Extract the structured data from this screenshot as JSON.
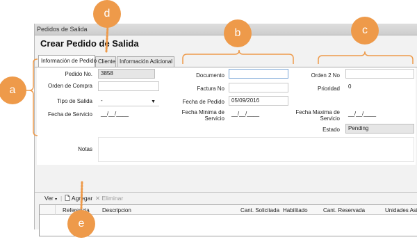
{
  "window": {
    "title": "Pedidos de Salida"
  },
  "header": {
    "title": "Crear Pedido de Salida"
  },
  "tabs": [
    "Información de Pedido",
    "Cliente",
    "Información Adicional"
  ],
  "form": {
    "pedido_no_label": "Pedido No.",
    "pedido_no_value": "3858",
    "orden_compra_label": "Orden de Compra",
    "tipo_salida_label": "Tipo de Salida",
    "tipo_salida_value": "-",
    "fecha_servicio_label": "Fecha de Servicio",
    "fecha_servicio_value": "__/__/____",
    "documento_label": "Documento",
    "factura_no_label": "Factura No",
    "fecha_pedido_label": "Fecha de Pedido",
    "fecha_pedido_value": "05/09/2016",
    "fecha_minima_label": "Fecha Minima de Servicio",
    "fecha_minima_value": "__/__/____",
    "orden2_label": "Orden 2 No",
    "prioridad_label": "Prioridad",
    "prioridad_value": "0",
    "fecha_maxima_label": "Fecha Maxima de Servicio",
    "fecha_maxima_value": "__/__/____",
    "estado_label": "Estado",
    "estado_value": "Pending",
    "notas_label": "Notas"
  },
  "toolbar": {
    "ver_label": "Ver",
    "agregar_label": "Agregar",
    "eliminar_label": "Eliminar"
  },
  "grid": {
    "columns": [
      "Referencia",
      "Descripcion",
      "Cant. Solicitada",
      "Habilitado",
      "Cant. Reservada",
      "Unidades Asig"
    ]
  },
  "callouts": {
    "a": "a",
    "b": "b",
    "c": "c",
    "d": "d",
    "e": "e"
  },
  "colors": {
    "annotation": "#ee9a4a",
    "focus_border": "#7aa6d6"
  }
}
